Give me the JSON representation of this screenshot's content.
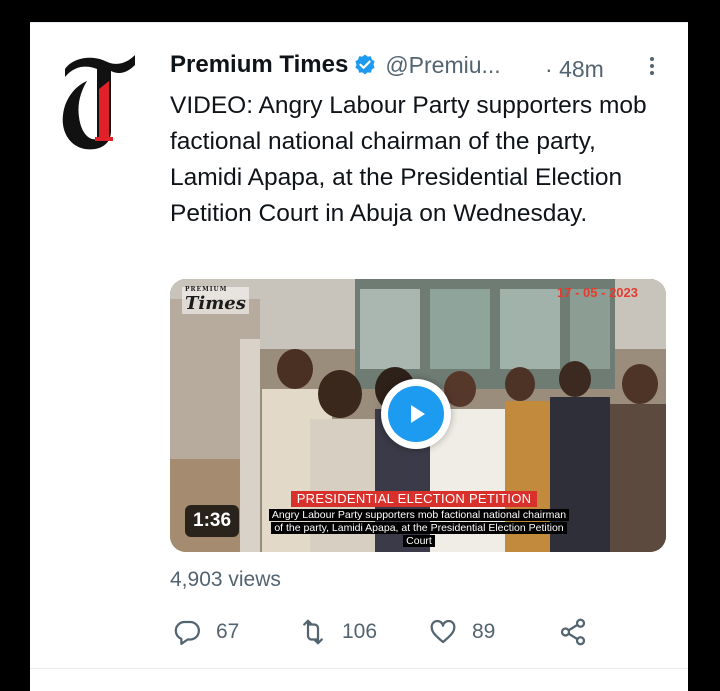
{
  "tweet": {
    "author_name": "Premium Times",
    "handle": "@Premiu...",
    "separator": "·",
    "time": "48m",
    "text": "VIDEO: Angry Labour Party supporters mob factional national chairman of the party, Lamidi Apapa, at the Presidential Election Petition Court in Abuja on Wednesday.",
    "avatar_icon": "premium-times-logo",
    "avatar_letters": "T1"
  },
  "media": {
    "duration": "1:36",
    "watermark": "Times",
    "watermark_small": "PREMIUM",
    "date": "17 - 05 - 2023",
    "lower_title": "PRESIDENTIAL ELECTION PETITION",
    "lower_caption": "Angry Labour Party supporters mob factional national chairman of the party, Lamidi Apapa, at the Presidential Election Petition Court"
  },
  "stats": {
    "views": "4,903 views",
    "replies": "67",
    "retweets": "106",
    "likes": "89"
  },
  "colors": {
    "accent": "#1d9bf0",
    "text": "#0f1419",
    "secondary": "#536471",
    "banner_red": "#d8312c"
  },
  "icons": {
    "verified": "verified-badge-icon",
    "more": "more-icon",
    "reply": "reply-icon",
    "retweet": "retweet-icon",
    "like": "heart-icon",
    "share": "share-icon",
    "play": "play-icon"
  }
}
